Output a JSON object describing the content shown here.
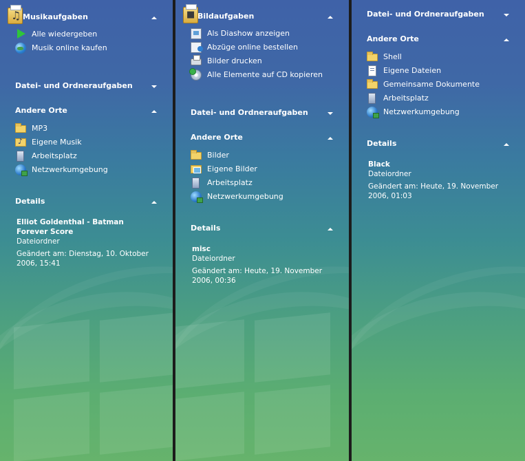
{
  "panes": [
    {
      "tasks": {
        "title": "Musikaufgaben",
        "icon": "music-folder-icon",
        "items": [
          {
            "label": "Alle wiedergeben",
            "icon": "play-icon"
          },
          {
            "label": "Musik online kaufen",
            "icon": "globe-icon"
          }
        ]
      },
      "file_tasks": {
        "title": "Datei- und Ordneraufgaben"
      },
      "other_places": {
        "title": "Andere Orte",
        "items": [
          {
            "label": "MP3",
            "icon": "folder-icon"
          },
          {
            "label": "Eigene Musik",
            "icon": "music-folder-icon"
          },
          {
            "label": "Arbeitsplatz",
            "icon": "computer-icon"
          },
          {
            "label": "Netzwerkumgebung",
            "icon": "network-icon"
          }
        ]
      },
      "details": {
        "title": "Details",
        "name": "Elliot Goldenthal - Batman Forever Score",
        "type": "Dateiordner",
        "modified": "Geändert am: Dienstag, 10. Oktober 2006, 15:41"
      }
    },
    {
      "tasks": {
        "title": "Bildaufgaben",
        "icon": "picture-folder-icon",
        "items": [
          {
            "label": "Als Diashow anzeigen",
            "icon": "slideshow-icon"
          },
          {
            "label": "Abzüge online bestellen",
            "icon": "order-prints-icon"
          },
          {
            "label": "Bilder drucken",
            "icon": "printer-icon"
          },
          {
            "label": "Alle Elemente auf CD kopieren",
            "icon": "cd-icon"
          }
        ]
      },
      "file_tasks": {
        "title": "Datei- und Ordneraufgaben"
      },
      "other_places": {
        "title": "Andere Orte",
        "items": [
          {
            "label": "Bilder",
            "icon": "folder-icon"
          },
          {
            "label": "Eigene Bilder",
            "icon": "picture-folder-icon"
          },
          {
            "label": "Arbeitsplatz",
            "icon": "computer-icon"
          },
          {
            "label": "Netzwerkumgebung",
            "icon": "network-icon"
          }
        ]
      },
      "details": {
        "title": "Details",
        "name": "misc",
        "type": "Dateiordner",
        "modified": "Geändert am: Heute, 19. November 2006, 00:36"
      }
    },
    {
      "file_tasks": {
        "title": "Datei- und Ordneraufgaben"
      },
      "other_places": {
        "title": "Andere Orte",
        "items": [
          {
            "label": "Shell",
            "icon": "folder-icon"
          },
          {
            "label": "Eigene Dateien",
            "icon": "documents-icon"
          },
          {
            "label": "Gemeinsame Dokumente",
            "icon": "folder-icon"
          },
          {
            "label": "Arbeitsplatz",
            "icon": "computer-icon"
          },
          {
            "label": "Netzwerkumgebung",
            "icon": "network-icon"
          }
        ]
      },
      "details": {
        "title": "Details",
        "name": "Black",
        "type": "Dateiordner",
        "modified": "Geändert am: Heute, 19. November 2006, 01:03"
      }
    }
  ]
}
